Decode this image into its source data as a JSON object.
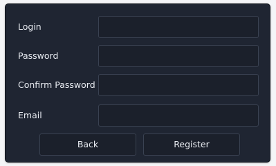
{
  "form": {
    "fields": [
      {
        "label": "Login",
        "value": "",
        "placeholder": ""
      },
      {
        "label": "Password",
        "value": "",
        "placeholder": ""
      },
      {
        "label": "Confirm Password",
        "value": "",
        "placeholder": ""
      },
      {
        "label": "Email",
        "value": "",
        "placeholder": ""
      }
    ],
    "back_label": "Back",
    "register_label": "Register"
  },
  "colors": {
    "background": "#1f2532",
    "field_background": "#1b202b",
    "border": "#3a4252",
    "text": "#e8ebf1"
  }
}
